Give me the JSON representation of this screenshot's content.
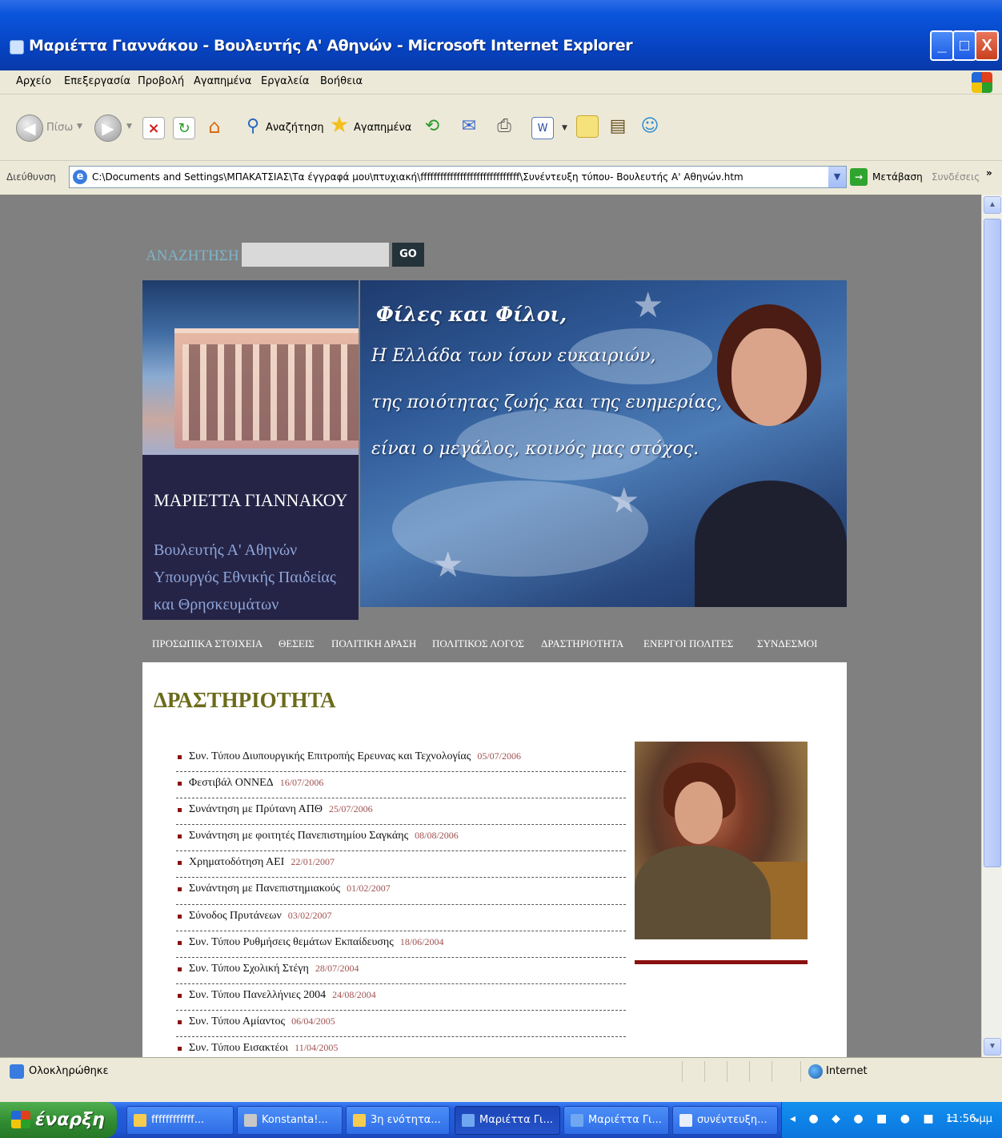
{
  "window": {
    "title": "Μαριέττα Γιαννάκου - Βουλευτής Α' Αθηνών - Microsoft Internet Explorer",
    "controls": {
      "minimize": "_",
      "maximize": "□",
      "close": "X"
    }
  },
  "menubar": [
    "Αρχείο",
    "Επεξεργασία",
    "Προβολή",
    "Αγαπημένα",
    "Εργαλεία",
    "Βοήθεια"
  ],
  "toolbar": {
    "back_label": "Πίσω",
    "search_label": "Αναζήτηση",
    "favorites_label": "Αγαπημένα",
    "icons": [
      "back-icon",
      "forward-icon",
      "stop-icon",
      "refresh-icon",
      "home-icon",
      "search-icon",
      "favorites-star-icon",
      "history-icon",
      "mail-icon",
      "print-icon",
      "word-icon",
      "note-icon",
      "research-icon",
      "messenger-icon"
    ]
  },
  "address": {
    "label": "Διεύθυνση",
    "url": "C:\\Documents and Settings\\ΜΠΑΚΑΤΣΙΑΣ\\Τα έγγραφά μου\\πτυχιακή\\ffffffffffffffffffffffffffffff\\Συνέντευξη τύπου- Βουλευτής Α' Αθηνών.htm",
    "go_label": "Μετάβαση",
    "links_label": "Συνδέσεις",
    "more": "»"
  },
  "page": {
    "search_label": "ΑΝΑΖΗΤΗΣΗ",
    "search_value": "",
    "go_button": "GO",
    "name": "ΜΑΡΙΕΤΤΑ ΓΙΑΝΝΑΚΟΥ",
    "roles": [
      "Βουλευτής Α' Αθηνών",
      "Υπουργός Εθνικής Παιδείας",
      "και Θρησκευμάτων"
    ],
    "banner_quote": [
      "Φίλες και Φίλοι,",
      "Η Ελλάδα των ίσων ευκαιριών,",
      "της ποιότητας ζωής και της ευημερίας,",
      "είναι ο μεγάλος, κοινός μας στόχος."
    ],
    "nav": [
      "ΠΡΟΣΩΠΙΚΑ ΣΤΟΙΧΕΙΑ",
      "ΘΕΣΕΙΣ",
      "ΠΟΛΙΤΙΚΗ ΔΡΑΣΗ",
      "ΠΟΛΙΤΙΚΟΣ ΛΟΓΟΣ",
      "ΔΡΑΣΤΗΡΙΟΤΗΤΑ",
      "ΕΝΕΡΓΟΙ ΠΟΛΙΤΕΣ",
      "ΣΥΝΔΕΣΜΟΙ"
    ],
    "section_title": "ΔΡΑΣΤΗΡΙΟΤΗΤΑ",
    "activities": [
      {
        "title": "Συν. Τύπου Διυπουργικής Επιτροπής Ερευνας και Τεχνολογίας",
        "date": "05/07/2006"
      },
      {
        "title": "Φεστιβάλ ΟΝΝΕΔ",
        "date": "16/07/2006"
      },
      {
        "title": "Συνάντηση με Πρύτανη ΑΠΘ",
        "date": "25/07/2006"
      },
      {
        "title": "Συνάντηση με φοιτητές Πανεπιστημίου Σαγκάης",
        "date": "08/08/2006"
      },
      {
        "title": "Χρηματοδότηση ΑΕΙ",
        "date": "22/01/2007"
      },
      {
        "title": "Συνάντηση με Πανεπιστημιακούς",
        "date": "01/02/2007"
      },
      {
        "title": "Σύνοδος Πρυτάνεων",
        "date": "03/02/2007"
      },
      {
        "title": "Συν. Τύπου Ρυθμήσεις θεμάτων Εκπαίδευσης",
        "date": "18/06/2004"
      },
      {
        "title": "Συν. Τύπου Σχολική Στέγη",
        "date": "28/07/2004"
      },
      {
        "title": "Συν. Τύπου Πανελλήνιες 2004",
        "date": "24/08/2004"
      },
      {
        "title": "Συν. Τύπου Αμίαντος",
        "date": "06/04/2005"
      },
      {
        "title": "Συν. Τύπου Εισακτέοι",
        "date": "11/04/2005"
      }
    ]
  },
  "status": {
    "text": "Ολοκληρώθηκε",
    "zone": "Internet"
  },
  "taskbar": {
    "start": "έναρξη",
    "tasks": [
      "ffffffffffff...",
      "Konstanta!...",
      "3η ενότητα...",
      "Μαριέττα Γι...",
      "Μαριέττα Γι...",
      "συνέντευξη..."
    ],
    "active_index": 3,
    "clock": "11:56 μμ"
  },
  "colors": {
    "page_bg": "#808080",
    "name_box": "#252447",
    "title_olive": "#6b6a1a",
    "accent_red": "#8a0f0f",
    "date_color": "#a05050"
  }
}
